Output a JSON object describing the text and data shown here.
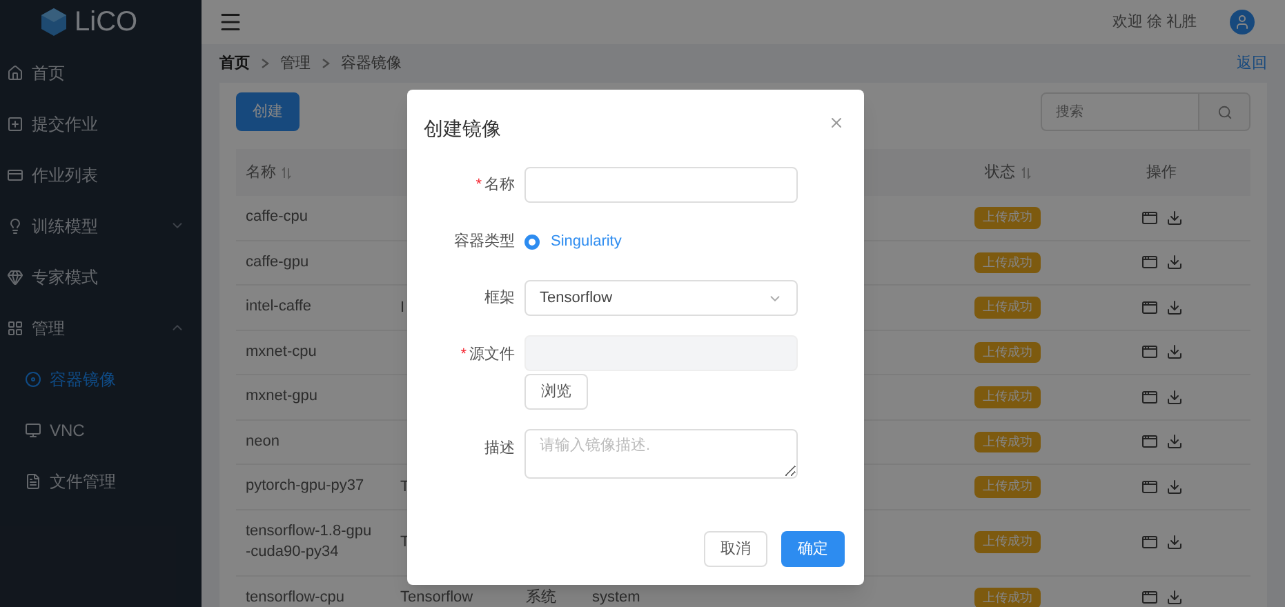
{
  "logo": {
    "text": "LiCO"
  },
  "sidebar": {
    "items": [
      {
        "label": "首页",
        "kind": "home",
        "selected": false
      },
      {
        "label": "提交作业",
        "kind": "submit",
        "selected": false
      },
      {
        "label": "作业列表",
        "kind": "list",
        "selected": false
      },
      {
        "label": "训练模型",
        "kind": "model",
        "selected": false,
        "expanded": false
      },
      {
        "label": "专家模式",
        "kind": "expert",
        "selected": false
      },
      {
        "label": "管理",
        "kind": "admin",
        "selected": false,
        "expanded": true,
        "children": [
          {
            "label": "容器镜像",
            "kind": "image",
            "selected": true
          },
          {
            "label": "VNC",
            "kind": "vnc",
            "selected": false
          },
          {
            "label": "文件管理",
            "kind": "files",
            "selected": false
          }
        ]
      }
    ]
  },
  "header": {
    "welcome": "欢迎 徐 礼胜"
  },
  "breadcrumb": [
    "首页",
    "管理",
    "容器镜像"
  ],
  "back_link": "返回",
  "create_button": "创建",
  "search": {
    "placeholder": "搜索"
  },
  "table": {
    "columns": [
      "名称",
      "状态",
      "操作"
    ],
    "rows": [
      {
        "name": "caffe-cpu",
        "status": "上传成功"
      },
      {
        "name": "caffe-gpu",
        "status": "上传成功"
      },
      {
        "name": "intel-caffe",
        "column_2": "I",
        "status": "上传成功"
      },
      {
        "name": "mxnet-cpu",
        "status": "上传成功"
      },
      {
        "name": "mxnet-gpu",
        "status": "上传成功"
      },
      {
        "name": "neon",
        "status": "上传成功"
      },
      {
        "name": "pytorch-gpu-py37",
        "column_2": "T",
        "status": "上传成功"
      },
      {
        "name": "tensorflow-1.8-gpu\n-cuda90-py34",
        "column_2": "T",
        "status": "上传成功"
      },
      {
        "name": "tensorflow-cpu",
        "column_2": "Tensorflow",
        "column_3": "系统",
        "column_4": "system",
        "status": "上传成功"
      }
    ]
  },
  "dialog": {
    "title": "创建镜像",
    "required_mark": "*",
    "fields": [
      {
        "kind": "text",
        "label": "名称",
        "required": true
      },
      {
        "kind": "radio",
        "label": "容器类型",
        "required": false,
        "options": [
          {
            "label": "Singularity",
            "selected": true
          }
        ]
      },
      {
        "kind": "select",
        "label": "框架",
        "required": false,
        "value": "Tensorflow"
      },
      {
        "kind": "file",
        "label": "源文件",
        "required": true,
        "disabled": true,
        "button": "浏览"
      },
      {
        "kind": "textarea",
        "label": "描述",
        "required": false,
        "placeholder": "请输入镜像描述."
      }
    ],
    "buttons": [
      {
        "label": "取消",
        "primary": false
      },
      {
        "label": "确定",
        "primary": true
      }
    ]
  }
}
